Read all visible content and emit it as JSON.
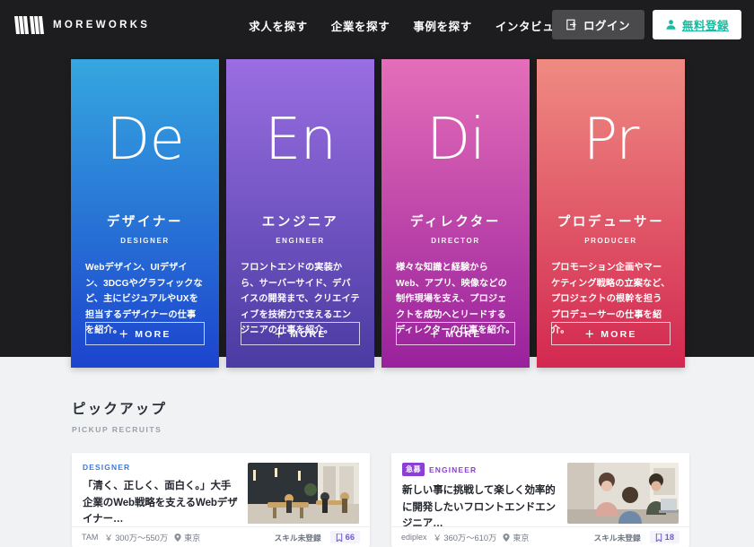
{
  "header": {
    "logo_text": "MOREWORKS",
    "logo_icon": "mw-logo-icon",
    "nav": [
      {
        "label": "求人を探す"
      },
      {
        "label": "企業を探す"
      },
      {
        "label": "事例を探す"
      },
      {
        "label": "インタビュー"
      }
    ],
    "login_label": "ログイン",
    "login_icon": "login-arrow-icon",
    "signup_label": "無料登録",
    "signup_icon": "person-add-icon",
    "signup_color": "#18bba0",
    "background_color": "#1d1d1f"
  },
  "hero": {
    "cards": [
      {
        "initial": "De",
        "title": "デザイナー",
        "subtitle": "DESIGNER",
        "description": "Webデザイン、UIデザイン、3DCGやグラフィックなど、主にビジュアルやUXを担当するデザイナーの仕事を紹介。",
        "more_label": "＋ MORE",
        "gradient_from": "#35a7df",
        "gradient_to": "#1c44ce"
      },
      {
        "initial": "En",
        "title": "エンジニア",
        "subtitle": "ENGINEER",
        "description": "フロントエンドの実装から、サーバーサイド、デバイスの開発まで、クリエイティブを技術力で支えるエンジニアの仕事を紹介。",
        "more_label": "＋ MORE",
        "gradient_from": "#9a6ee2",
        "gradient_to": "#4a3ba2"
      },
      {
        "initial": "Di",
        "title": "ディレクター",
        "subtitle": "DIRECTOR",
        "description": "様々な知識と経験からWeb、アプリ、映像などの制作現場を支え、プロジェクトを成功へとリードするディレクターの仕事を紹介。",
        "more_label": "＋ MORE",
        "gradient_from": "#e56eb9",
        "gradient_to": "#99219c"
      },
      {
        "initial": "Pr",
        "title": "プロデューサー",
        "subtitle": "PRODUCER",
        "description": "プロモーション企画やマーケティング戦略の立案など、プロジェクトの根幹を担うプロデューサーの仕事を紹介。",
        "more_label": "＋ MORE",
        "gradient_from": "#ef8b82",
        "gradient_to": "#d32850"
      }
    ]
  },
  "pickup": {
    "title": "ピックアップ",
    "subtitle": "PICKUP RECRUITS",
    "recruits": [
      {
        "badge": "",
        "category": "DESIGNER",
        "category_color": "#3d7bd9",
        "title": "「清く、正しく、面白く。」大手企業のWeb戦略を支えるWebデザイナー…",
        "company": "TAM",
        "salary": "￥ 300万～550万",
        "location": "東京",
        "location_icon": "map-pin-icon",
        "skill": "スキル未登録",
        "bookmark_icon": "bookmark-icon",
        "bookmark_count": "66"
      },
      {
        "badge": "急募",
        "category": "ENGINEER",
        "category_color": "#8b3fd4",
        "title": "新しい事に挑戦して楽しく効率的に開発したいフロントエンドエンジニア…",
        "company": "ediplex",
        "salary": "￥ 360万～610万",
        "location": "東京",
        "location_icon": "map-pin-icon",
        "skill": "スキル未登録",
        "bookmark_icon": "bookmark-icon",
        "bookmark_count": "18"
      }
    ]
  }
}
